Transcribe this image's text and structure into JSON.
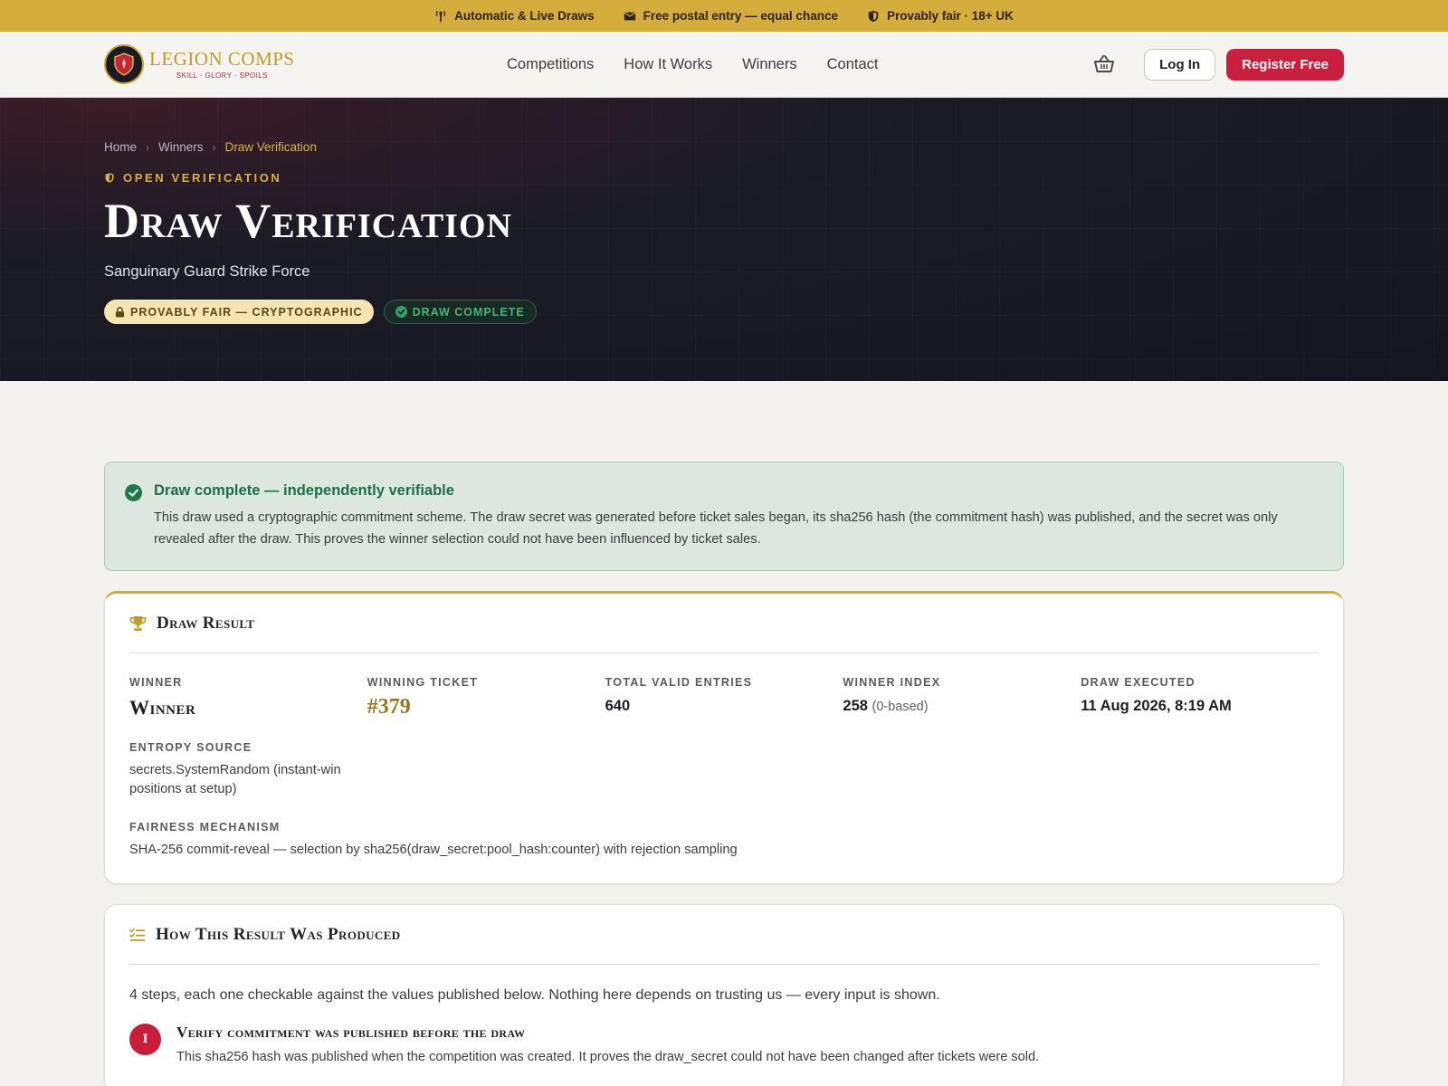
{
  "topbar": {
    "items": [
      {
        "icon": "broadcast-icon",
        "label": "Automatic & Live Draws"
      },
      {
        "icon": "envelope-icon",
        "label": "Free postal entry — equal chance"
      },
      {
        "icon": "shield-icon",
        "label": "Provably fair · 18+ UK"
      }
    ]
  },
  "header": {
    "logo": {
      "name": "LEGION COMPS",
      "tagline": "SKILL · GLORY · SPOILS"
    },
    "nav": [
      "Competitions",
      "How It Works",
      "Winners",
      "Contact"
    ],
    "cart_icon": "basket-icon",
    "login_label": "Log In",
    "register_label": "Register Free"
  },
  "hero": {
    "breadcrumb": [
      "Home",
      "Winners",
      "Draw Verification"
    ],
    "eyebrow": "OPEN VERIFICATION",
    "title": "Draw Verification",
    "subtitle": "Sanguinary Guard Strike Force",
    "badge_fair": "PROVABLY FAIR — CRYPTOGRAPHIC",
    "badge_complete": "DRAW COMPLETE"
  },
  "alert": {
    "title": "Draw complete — independently verifiable",
    "body": "This draw used a cryptographic commitment scheme. The draw secret was generated before ticket sales began, its sha256 hash (the commitment hash) was published, and the secret was only revealed after the draw. This proves the winner selection could not have been influenced by ticket sales."
  },
  "result": {
    "title": "Draw Result",
    "winner_label": "WINNER",
    "winner_value": "Winner",
    "ticket_label": "WINNING TICKET",
    "ticket_value": "#379",
    "entries_label": "TOTAL VALID ENTRIES",
    "entries_value": "640",
    "index_label": "WINNER INDEX",
    "index_value": "258",
    "index_note": "(0-based)",
    "executed_label": "DRAW EXECUTED",
    "executed_value": "11 Aug 2026, 8:19 AM",
    "entropy_label": "ENTROPY SOURCE",
    "entropy_value": "secrets.SystemRandom (instant-win positions at setup)",
    "mechanism_label": "FAIRNESS MECHANISM",
    "mechanism_value": "SHA-256 commit-reveal — selection by sha256(draw_secret:pool_hash:counter) with rejection sampling"
  },
  "how": {
    "title": "How This Result Was Produced",
    "intro": "4 steps, each one checkable against the values published below. Nothing here depends on trusting us — every input is shown.",
    "steps": [
      {
        "number": "I",
        "title": "Verify commitment was published before the draw",
        "desc": "This sha256 hash was published when the competition was created. It proves the draw_secret could not have been changed after tickets were sold."
      }
    ]
  },
  "colors": {
    "gold": "#d5ad3c",
    "crimson": "#c8203e",
    "success": "#1f6e44",
    "hero_bg": "#16161f"
  }
}
